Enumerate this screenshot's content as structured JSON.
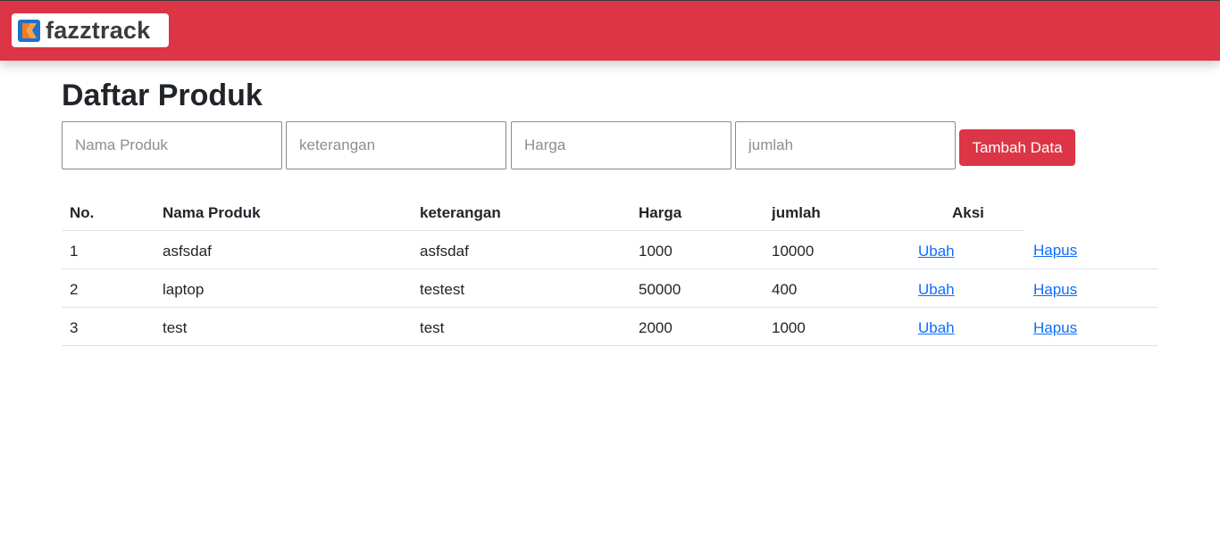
{
  "brand": {
    "name": "fazztrack"
  },
  "colors": {
    "navbar": "#dc3545",
    "button": "#dc3545",
    "link": "#0d6efd"
  },
  "page": {
    "title": "Daftar Produk"
  },
  "form": {
    "name_placeholder": "Nama Produk",
    "desc_placeholder": "keterangan",
    "price_placeholder": "Harga",
    "qty_placeholder": "jumlah",
    "submit_label": "Tambah Data"
  },
  "table": {
    "headers": [
      "No.",
      "Nama Produk",
      "keterangan",
      "Harga",
      "jumlah",
      "Aksi"
    ],
    "rows": [
      {
        "no": "1",
        "name": "asfsdaf",
        "desc": "asfsdaf",
        "price": "1000",
        "qty": "10000",
        "edit": "Ubah",
        "delete": "Hapus"
      },
      {
        "no": "2",
        "name": "laptop",
        "desc": "testest",
        "price": "50000",
        "qty": "400",
        "edit": "Ubah",
        "delete": "Hapus"
      },
      {
        "no": "3",
        "name": "test",
        "desc": "test",
        "price": "2000",
        "qty": "1000",
        "edit": "Ubah",
        "delete": "Hapus"
      }
    ]
  }
}
